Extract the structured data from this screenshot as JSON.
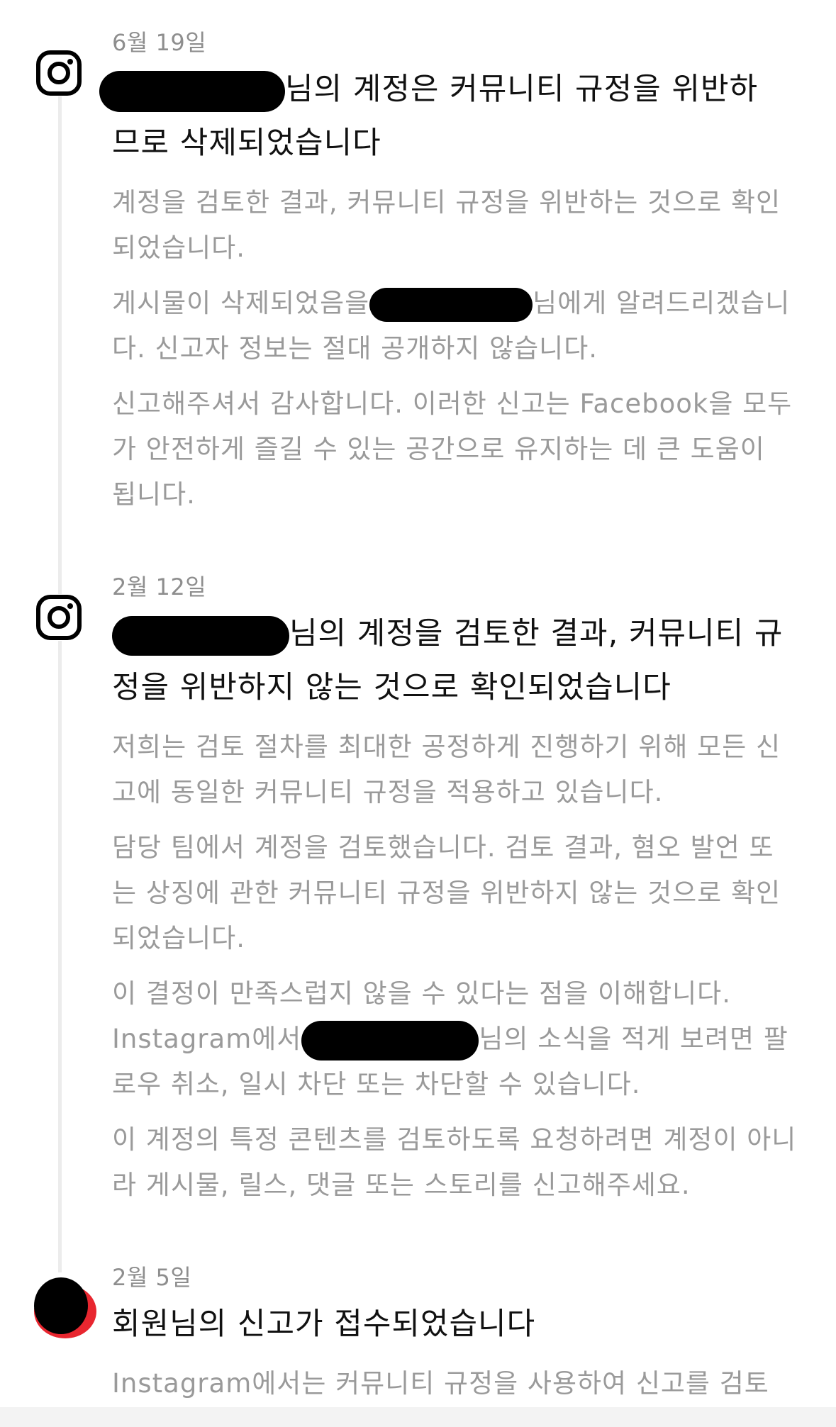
{
  "entries": [
    {
      "icon": "instagram-icon",
      "date": "6월 19일",
      "title_suffix": "님의 계정은 커뮤니티 규정을 위반하",
      "title_line2": "므로 삭제되었습니다",
      "paragraphs": {
        "p1": "계정을 검토한 결과, 커뮤니티 규정을 위반하는 것으로 확인되었습니다.",
        "p2_prefix": "게시물이 삭제되었음을",
        "p2_suffix": "님에게 알려드리겠습니다. 신고자 정보는 절대 공개하지 않습니다.",
        "p3": "신고해주셔서 감사합니다. 이러한 신고는 Facebook을 모두가 안전하게 즐길 수 있는 공간으로 유지하는 데 큰 도움이 됩니다."
      }
    },
    {
      "icon": "instagram-icon",
      "date": "2월 12일",
      "title_suffix": "님의 계정을 검토한 결과, 커뮤니티 규",
      "title_line2": "정을 위반하지 않는 것으로 확인되었습니다",
      "paragraphs": {
        "p1": "저희는 검토 절차를 최대한 공정하게 진행하기 위해 모든 신고에 동일한 커뮤니티 규정을 적용하고 있습니다.",
        "p2": "담당 팀에서 계정을 검토했습니다. 검토 결과, 혐오 발언 또는 상징에 관한 커뮤니티 규정을 위반하지 않는 것으로 확인되었습니다.",
        "p3_line1": "이 결정이 만족스럽지 않을 수 있다는 점을 이해합니다.",
        "p3_prefix": "Instagram에서",
        "p3_suffix": "님의 소식을 적게 보려면 팔로우 취소, 일시 차단 또는 차단할 수 있습니다.",
        "p4": "이 계정의 특정 콘텐츠를 검토하도록 요청하려면 계정이 아니라 게시물, 릴스, 댓글 또는 스토리를 신고해주세요."
      }
    },
    {
      "icon": "avatar",
      "date": "2월 5일",
      "title": "회원님의 신고가 접수되었습니다",
      "paragraphs": {
        "p1": "Instagram에서는 커뮤니티 규정을 사용하여 신고를 검토"
      }
    }
  ],
  "colors": {
    "title": "#111111",
    "body_text": "#9a9a9a",
    "date": "#8e8e8e",
    "timeline": "#ececec",
    "redaction": "#000000",
    "avatar_red": "#e8262f"
  }
}
